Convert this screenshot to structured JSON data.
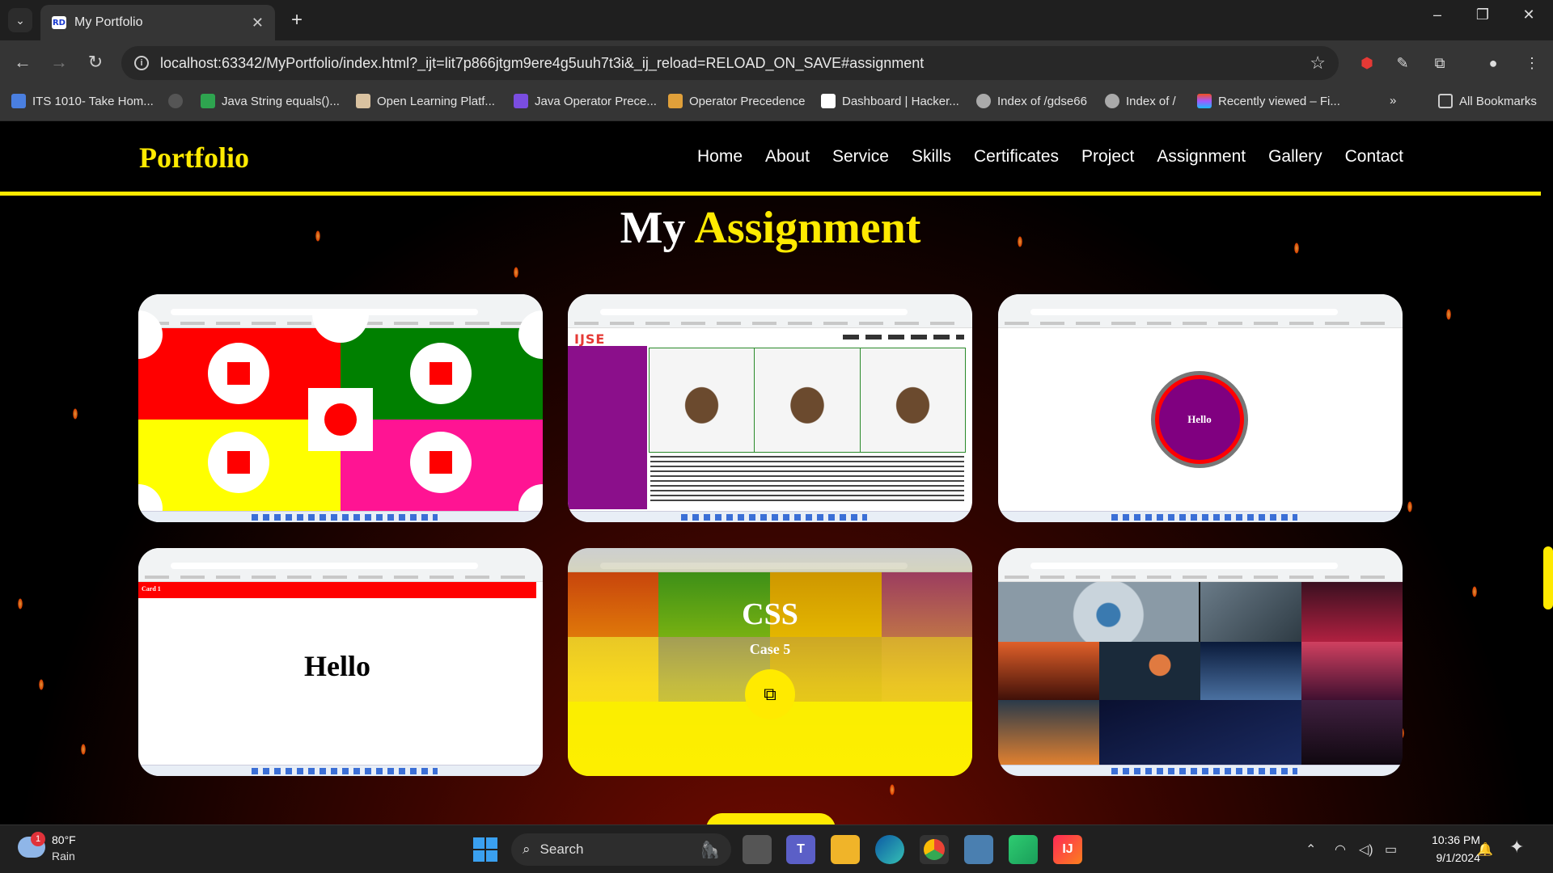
{
  "browser": {
    "tab_title": "My Portfolio",
    "tab_favicon_text": "RD",
    "url": "localhost:63342/MyPortfolio/index.html?_ijt=lit7p866jtgm9ere4g5uuh7t3i&_ij_reload=RELOAD_ON_SAVE#assignment",
    "bookmarks": [
      "ITS 1010- Take Hom...",
      "",
      "Java String equals()...",
      "Open Learning Platf...",
      "Java Operator Prece...",
      "Operator Precedence",
      "Dashboard | Hacker...",
      "Index of /gdse66",
      "Index of /",
      "Recently viewed – Fi..."
    ],
    "bookmarks_more": "»",
    "all_bookmarks": "All Bookmarks"
  },
  "site": {
    "logo": "Portfolio",
    "nav": [
      "Home",
      "About",
      "Service",
      "Skills",
      "Certificates",
      "Project",
      "Assignment",
      "Gallery",
      "Contact"
    ],
    "section_title_prefix": "My",
    "section_title_accent": "Assignment",
    "cards": {
      "card3_label": "Hello",
      "card4_bar": "Card 1",
      "card4_text": "Hello",
      "card5_title": "CSS",
      "card5_subtitle": "Case 5"
    },
    "colors": {
      "accent": "#ffea00",
      "background": "#000000"
    }
  },
  "taskbar": {
    "weather_temp": "80°F",
    "weather_cond": "Rain",
    "weather_badge": "1",
    "search_label": "Search",
    "time": "10:36 PM",
    "date": "9/1/2024"
  }
}
